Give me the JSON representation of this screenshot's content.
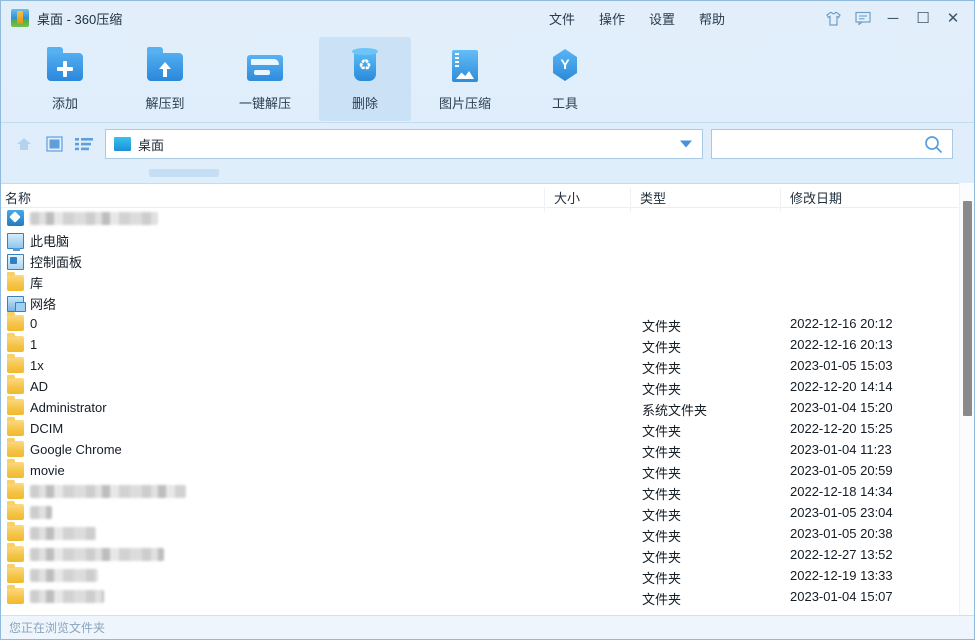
{
  "window": {
    "title": "桌面 - 360压缩",
    "app_icon": "app-logo-icon"
  },
  "menu": {
    "items": [
      {
        "label": "文件",
        "name": "menu-file"
      },
      {
        "label": "操作",
        "name": "menu-action"
      },
      {
        "label": "设置",
        "name": "menu-settings"
      },
      {
        "label": "帮助",
        "name": "menu-help"
      }
    ],
    "skin_icon": "shirt-icon",
    "feedback_icon": "message-icon",
    "minimize": "─",
    "maximize": "☐",
    "close": "✕"
  },
  "toolbar": {
    "buttons": [
      {
        "label": "添加",
        "icon": "add-folder-icon",
        "active": false
      },
      {
        "label": "解压到",
        "icon": "extract-to-icon",
        "active": false
      },
      {
        "label": "一键解压",
        "icon": "one-click-extract-icon",
        "active": false
      },
      {
        "label": "删除",
        "icon": "trash-icon",
        "active": true
      },
      {
        "label": "图片压缩",
        "icon": "image-compress-icon",
        "active": false
      },
      {
        "label": "工具",
        "icon": "tools-icon",
        "active": false
      }
    ]
  },
  "navbar": {
    "up_icon": "up-arrow-icon",
    "thumbnail_view_icon": "thumbnail-view-icon",
    "list_view_icon": "list-view-icon",
    "path_value": "桌面",
    "path_icon": "desktop-icon",
    "dropdown_icon": "chevron-down-icon",
    "search_value": "",
    "search_placeholder": "",
    "search_icon": "search-icon"
  },
  "list": {
    "columns": [
      {
        "label": "名称"
      },
      {
        "label": "大小"
      },
      {
        "label": "类型"
      },
      {
        "label": "修改日期"
      }
    ],
    "rows": [
      {
        "name": "",
        "redacted": true,
        "redact_width": 128,
        "icon": "app-icon",
        "size": "",
        "type": "",
        "date": ""
      },
      {
        "name": "此电脑",
        "redacted": false,
        "icon": "computer-icon",
        "size": "",
        "type": "",
        "date": ""
      },
      {
        "name": "控制面板",
        "redacted": false,
        "icon": "control-panel-icon",
        "size": "",
        "type": "",
        "date": ""
      },
      {
        "name": "库",
        "redacted": false,
        "icon": "folder-icon",
        "size": "",
        "type": "",
        "date": ""
      },
      {
        "name": "网络",
        "redacted": false,
        "icon": "network-icon",
        "size": "",
        "type": "",
        "date": ""
      },
      {
        "name": "0",
        "redacted": false,
        "icon": "folder-icon",
        "size": "",
        "type": "文件夹",
        "date": "2022-12-16 20:12"
      },
      {
        "name": "1",
        "redacted": false,
        "icon": "folder-icon",
        "size": "",
        "type": "文件夹",
        "date": "2022-12-16 20:13"
      },
      {
        "name": "1x",
        "redacted": false,
        "icon": "folder-icon",
        "size": "",
        "type": "文件夹",
        "date": "2023-01-05 15:03"
      },
      {
        "name": "AD",
        "redacted": false,
        "icon": "folder-icon",
        "size": "",
        "type": "文件夹",
        "date": "2022-12-20 14:14"
      },
      {
        "name": "Administrator",
        "redacted": false,
        "icon": "folder-icon",
        "size": "",
        "type": "系统文件夹",
        "date": "2023-01-04 15:20"
      },
      {
        "name": "DCIM",
        "redacted": false,
        "icon": "folder-icon",
        "size": "",
        "type": "文件夹",
        "date": "2022-12-20 15:25"
      },
      {
        "name": "Google Chrome",
        "redacted": false,
        "icon": "folder-icon",
        "size": "",
        "type": "文件夹",
        "date": "2023-01-04 11:23"
      },
      {
        "name": "movie",
        "redacted": false,
        "icon": "folder-icon",
        "size": "",
        "type": "文件夹",
        "date": "2023-01-05 20:59"
      },
      {
        "name": "",
        "redacted": true,
        "redact_width": 156,
        "icon": "folder-icon",
        "size": "",
        "type": "文件夹",
        "date": "2022-12-18 14:34"
      },
      {
        "name": "",
        "redacted": true,
        "redact_width": 22,
        "icon": "folder-icon",
        "size": "",
        "type": "文件夹",
        "date": "2023-01-05 23:04"
      },
      {
        "name": "",
        "redacted": true,
        "redact_width": 66,
        "icon": "folder-icon",
        "size": "",
        "type": "文件夹",
        "date": "2023-01-05 20:38"
      },
      {
        "name": "",
        "redacted": true,
        "redact_width": 134,
        "icon": "folder-icon",
        "size": "",
        "type": "文件夹",
        "date": "2022-12-27 13:52"
      },
      {
        "name": "",
        "redacted": true,
        "redact_width": 68,
        "icon": "folder-icon",
        "size": "",
        "type": "文件夹",
        "date": "2022-12-19 13:33"
      },
      {
        "name": "",
        "redacted": true,
        "redact_width": 74,
        "icon": "folder-icon",
        "size": "",
        "type": "文件夹",
        "date": "2023-01-04 15:07"
      }
    ]
  },
  "statusbar": {
    "text": "您正在浏览文件夹"
  },
  "colors": {
    "accent": "#2a87db",
    "title_bg": "#e2effb",
    "toolbar_active": "#cbe2f6",
    "folder_yellow": "#f5c445",
    "list_bg": "#ffffff",
    "status_text": "#8ba4bb"
  }
}
